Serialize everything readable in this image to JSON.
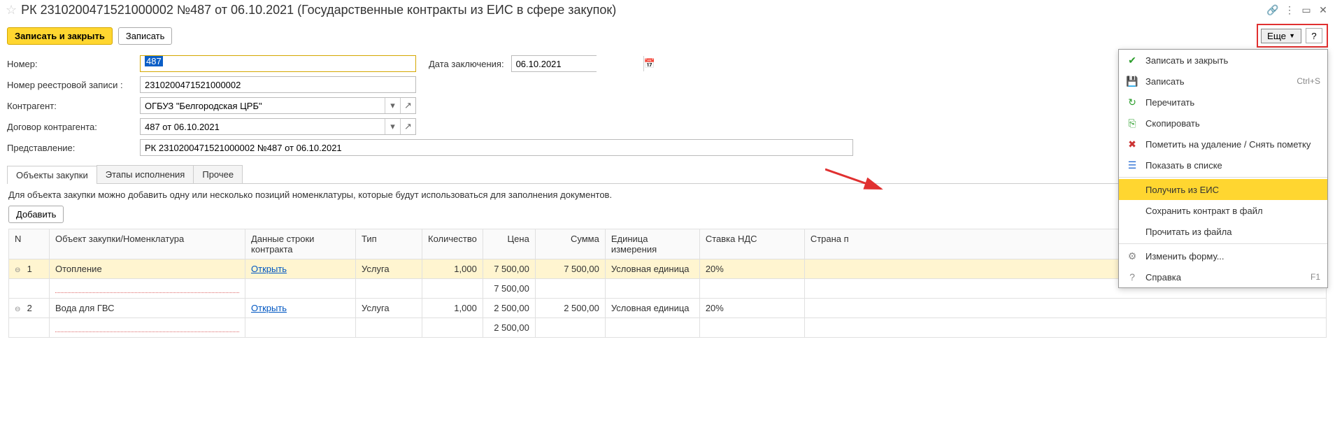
{
  "title": "РК 2310200471521000002 №487 от 06.10.2021 (Государственные контракты из ЕИС в сфере закупок)",
  "cmdbar": {
    "save_close": "Записать и закрыть",
    "save": "Записать",
    "more": "Еще",
    "help": "?"
  },
  "form": {
    "number_label": "Номер:",
    "number_value": "487",
    "date_label": "Дата заключения:",
    "date_value": "06.10.2021",
    "regnum_label": "Номер реестровой записи :",
    "regnum_value": "2310200471521000002",
    "contragent_label": "Контрагент:",
    "contragent_value": "ОГБУЗ \"Белгородская ЦРБ\"",
    "contract_label": "Договор контрагента:",
    "contract_value": "487 от 06.10.2021",
    "present_label": "Представление:",
    "present_value": "РК 2310200471521000002 №487 от 06.10.2021"
  },
  "tabs": {
    "t1": "Объекты закупки",
    "t2": "Этапы исполнения",
    "t3": "Прочее"
  },
  "hint": "Для объекта закупки можно добавить одну или несколько позиций номенклатуры, которые будут использоваться для заполнения документов.",
  "add": "Добавить",
  "table": {
    "headers": {
      "n": "N",
      "name": "Объект закупки/Номенклатура",
      "data": "Данные строки контракта",
      "type": "Тип",
      "qty": "Количество",
      "price": "Цена",
      "sum": "Сумма",
      "unit": "Единица измерения",
      "vat": "Ставка НДС",
      "country": "Страна п"
    },
    "rows": [
      {
        "n": "1",
        "name": "Отопление",
        "data": "Открыть",
        "type": "Услуга",
        "qty": "1,000",
        "price": "7 500,00",
        "sum": "7 500,00",
        "unit": "Условная единица",
        "vat": "20%"
      },
      {
        "n": "2",
        "name": "Вода для ГВС",
        "data": "Открыть",
        "type": "Услуга",
        "qty": "1,000",
        "price": "2 500,00",
        "sum": "2 500,00",
        "unit": "Условная единица",
        "vat": "20%"
      }
    ],
    "subtotals": [
      "7 500,00",
      "2 500,00"
    ]
  },
  "menu": {
    "items": [
      {
        "label": "Записать и закрыть",
        "shortcut": "",
        "icon": "✓",
        "color": "#2a9d2a"
      },
      {
        "label": "Записать",
        "shortcut": "Ctrl+S",
        "icon": "💾",
        "color": "#2a6ed4"
      },
      {
        "label": "Перечитать",
        "shortcut": "",
        "icon": "↻",
        "color": "#2a9d2a"
      },
      {
        "label": "Скопировать",
        "shortcut": "",
        "icon": "📄",
        "color": "#2a9d2a"
      },
      {
        "label": "Пометить на удаление / Снять пометку",
        "shortcut": "",
        "icon": "✖",
        "color": "#c33"
      },
      {
        "label": "Показать в списке",
        "shortcut": "",
        "icon": "☰",
        "color": "#2a6ed4"
      }
    ],
    "group2": [
      {
        "label": "Получить из ЕИС",
        "highlight": true
      },
      {
        "label": "Сохранить контракт в файл"
      },
      {
        "label": "Прочитать из файла"
      }
    ],
    "group3": [
      {
        "label": "Изменить форму...",
        "icon": "⚙",
        "color": "#888"
      },
      {
        "label": "Справка",
        "shortcut": "F1",
        "icon": "?",
        "color": "#888"
      }
    ]
  }
}
